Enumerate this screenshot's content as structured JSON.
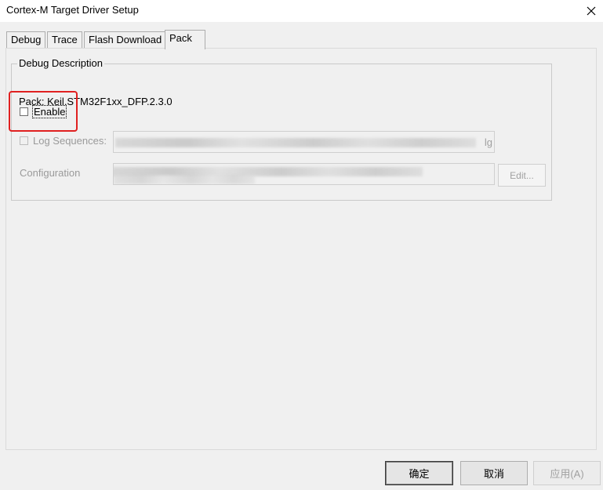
{
  "window": {
    "title": "Cortex-M Target Driver Setup",
    "close_glyph": "✕"
  },
  "tabs": [
    {
      "label": "Debug",
      "active": false
    },
    {
      "label": "Trace",
      "active": false
    },
    {
      "label": "Flash Download",
      "active": false
    },
    {
      "label": "Pack",
      "active": true
    }
  ],
  "group": {
    "title": "Debug Description",
    "pack_label": "Pack:",
    "pack_value": "Keil.STM32F1xx_DFP.2.3.0",
    "enable": {
      "label": "Enable",
      "checked": false
    },
    "log_sequences": {
      "label": "Log Sequences:",
      "checked": false,
      "enabled": false,
      "value_tail": "lg"
    },
    "configuration": {
      "label": "Configuration",
      "edit_label": "Edit..."
    }
  },
  "buttons": {
    "ok": "确定",
    "cancel": "取消",
    "apply": "应用(A)"
  },
  "colors": {
    "highlight": "#e02020",
    "disabled_text": "#9a9a9a",
    "background": "#f0f0f0"
  }
}
